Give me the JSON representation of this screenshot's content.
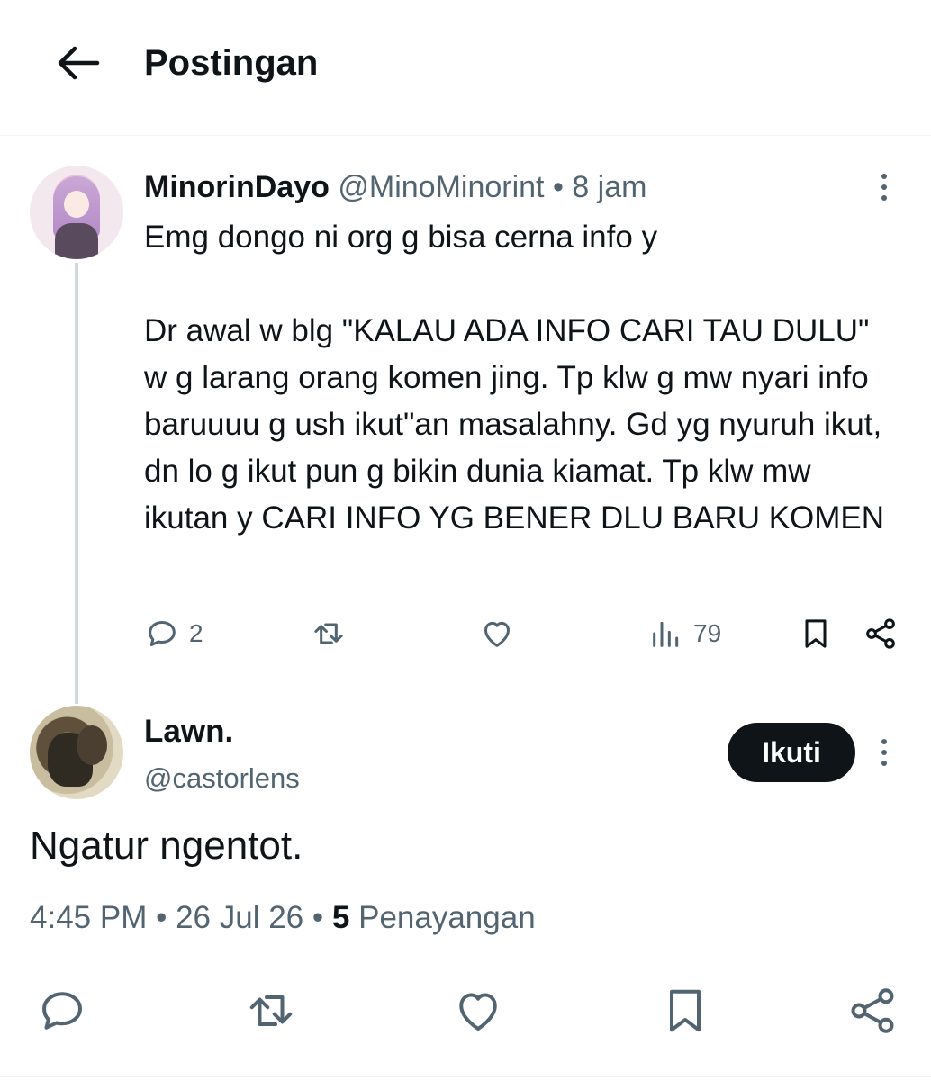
{
  "header": {
    "back_icon": "arrow-left-icon",
    "title": "Postingan"
  },
  "parent_tweet": {
    "display_name": "MinorinDayo",
    "handle": "@MinoMinorint",
    "separator": "•",
    "time": "8 jam",
    "text": "Emg dongo ni org g bisa cerna info y\n\nDr awal w blg \"KALAU ADA INFO CARI TAU DULU\" w g larang orang komen jing. Tp klw g mw nyari info baruuuu g ush ikut\"an masalahny. Gd yg nyuruh ikut, dn lo g ikut pun g bikin dunia kiamat. Tp klw mw ikutan y CARI INFO YG BENER DLU BARU KOMEN",
    "actions": {
      "reply_count": "2",
      "views_count": "79"
    },
    "icons": [
      "reply-icon",
      "retweet-icon",
      "like-icon",
      "views-icon",
      "bookmark-icon",
      "share-icon",
      "more-icon"
    ]
  },
  "reply_tweet": {
    "display_name": "Lawn.",
    "handle": "@castorlens",
    "follow_label": "Ikuti",
    "text": "Ngatur ngentot.",
    "time": "4:45 PM",
    "date": "26 Jul 26",
    "separator": "•",
    "views_count": "5",
    "views_label": "Penayangan"
  },
  "colors": {
    "text_primary": "#0f1419",
    "text_secondary": "#536471",
    "thread_line": "#cfd9de",
    "follow_bg": "#0f1419"
  }
}
